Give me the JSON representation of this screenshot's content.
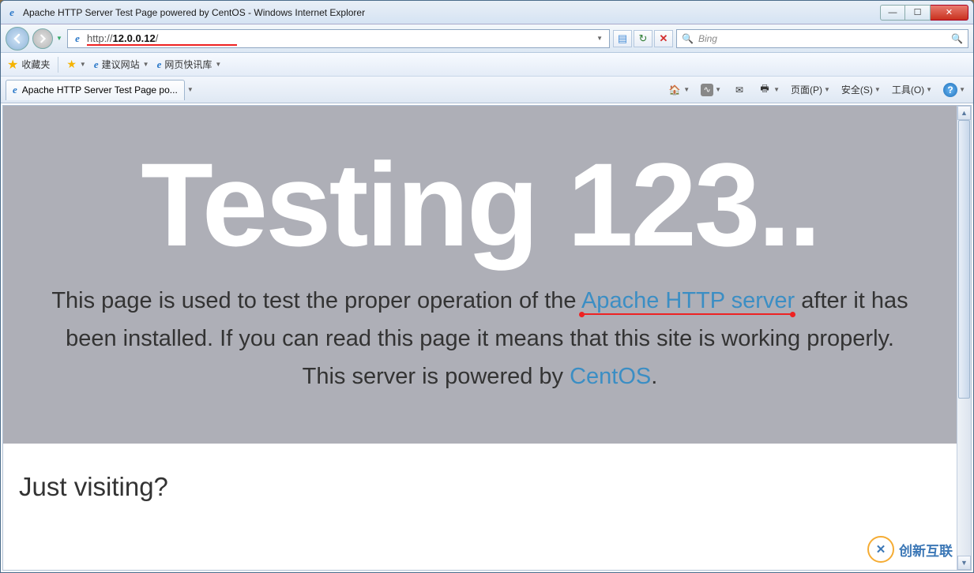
{
  "window": {
    "title": "Apache HTTP Server Test Page powered by CentOS - Windows Internet Explorer"
  },
  "nav": {
    "url_prefix": "http://",
    "url_host": "12.0.0.12",
    "url_suffix": "/",
    "search_placeholder": "Bing"
  },
  "favbar": {
    "favorites_label": "收藏夹",
    "suggested_sites": "建议网站",
    "web_slice": "网页快讯库"
  },
  "tab": {
    "title": "Apache HTTP Server Test Page po..."
  },
  "cmdbar": {
    "page": "页面(P)",
    "safety": "安全(S)",
    "tools": "工具(O)"
  },
  "content": {
    "hero_title": "Testing 123..",
    "lead_1": "This page is used to test the proper operation of the ",
    "lead_link1": "Apache HTTP server",
    "lead_2": " after it has been installed. If you can read this page it means that this site is working properly. This server is powered by ",
    "lead_link2": "CentOS",
    "lead_3": ".",
    "section_heading": "Just visiting?"
  },
  "watermark": {
    "text": "创新互联"
  }
}
